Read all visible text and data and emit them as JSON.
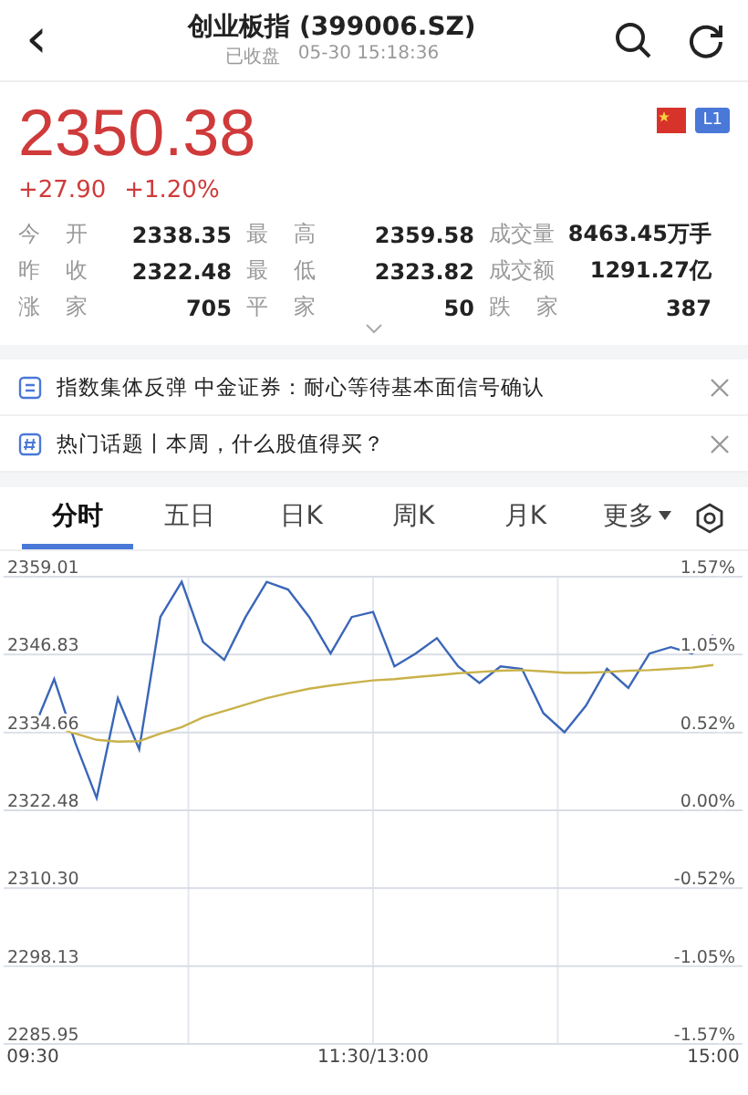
{
  "header": {
    "back": "‹",
    "title": "创业板指 (399006.SZ)",
    "status": "已收盘",
    "time": "05-30 15:18:36"
  },
  "quote": {
    "price": "2350.38",
    "change": "+27.90",
    "change_pct": "+1.20%",
    "badge": "L1"
  },
  "stats": [
    [
      {
        "label": "今 开",
        "value": "2338.35"
      },
      {
        "label": "最 高",
        "value": "2359.58"
      },
      {
        "label": "成交量",
        "value": "8463.45万手"
      }
    ],
    [
      {
        "label": "昨 收",
        "value": "2322.48"
      },
      {
        "label": "最 低",
        "value": "2323.82"
      },
      {
        "label": "成交额",
        "value": "1291.27亿"
      }
    ],
    [
      {
        "label": "涨 家",
        "value": "705"
      },
      {
        "label": "平 家",
        "value": "50"
      },
      {
        "label": "跌 家",
        "value": "387"
      }
    ]
  ],
  "notices": [
    {
      "kind": "news",
      "text": "指数集体反弹 中金证券：耐心等待基本面信号确认"
    },
    {
      "kind": "topic",
      "text": "热门话题丨本周，什么股值得买？"
    }
  ],
  "tabs": [
    {
      "label": "分时",
      "selected": true,
      "kind": "tab"
    },
    {
      "label": "五日",
      "selected": false,
      "kind": "tab"
    },
    {
      "label": "日K",
      "selected": false,
      "kind": "tab"
    },
    {
      "label": "周K",
      "selected": false,
      "kind": "tab"
    },
    {
      "label": "月K",
      "selected": false,
      "kind": "tab"
    },
    {
      "label": "更多",
      "selected": false,
      "kind": "menu"
    }
  ],
  "chart": {
    "pct_ticks": [
      "1.57%",
      "1.05%",
      "0.52%",
      "0.00%",
      "-0.52%",
      "-1.05%",
      "-1.57%"
    ],
    "chart_data": {
      "type": "line",
      "categories": [
        "09:30",
        null,
        null,
        null,
        null,
        null,
        null,
        null,
        null,
        null,
        null,
        null,
        null,
        null,
        null,
        null,
        "11:30/13:00",
        null,
        null,
        null,
        null,
        null,
        null,
        null,
        null,
        null,
        null,
        null,
        null,
        null,
        null,
        null,
        "15:00"
      ],
      "series": [
        {
          "color": "#3a66b8",
          "values": [
            2334.9,
            2343,
            2333,
            2324.4,
            2340,
            2332,
            2352.7,
            2358.2,
            2348.8,
            2346,
            2352.7,
            2358.2,
            2357,
            2352.7,
            2347,
            2352.7,
            2353.5,
            2345,
            2347,
            2349.4,
            2345,
            2342.4,
            2345,
            2344.6,
            2337.7,
            2334.7,
            2338.8,
            2344.6,
            2341.6,
            2347,
            2348,
            2347,
            2349.9
          ]
        },
        {
          "color": "#c9b24a",
          "values": [
            null,
            2335.5,
            2334.5,
            2333.5,
            2333.2,
            2333.3,
            2334.5,
            2335.5,
            2337,
            2338,
            2339,
            2340,
            2340.8,
            2341.5,
            2342,
            2342.4,
            2342.8,
            2343,
            2343.3,
            2343.6,
            2343.9,
            2344.1,
            2344.3,
            2344.4,
            2344.2,
            2344,
            2344,
            2344.1,
            2344.3,
            2344.4,
            2344.6,
            2344.8,
            2345.2
          ]
        }
      ],
      "ylim": [
        2285.95,
        2359.01
      ],
      "yticks": [
        {
          "value": 2359.01,
          "label": "2359.01"
        },
        {
          "value": 2346.83,
          "label": "2346.83"
        },
        {
          "value": 2334.66,
          "label": "2334.66"
        },
        {
          "value": 2322.48,
          "label": "2322.48"
        },
        {
          "value": 2310.3,
          "label": "2310.30"
        },
        {
          "value": 2298.13,
          "label": "2298.13"
        },
        {
          "value": 2285.95,
          "label": "2285.95"
        }
      ],
      "grid": true
    }
  }
}
